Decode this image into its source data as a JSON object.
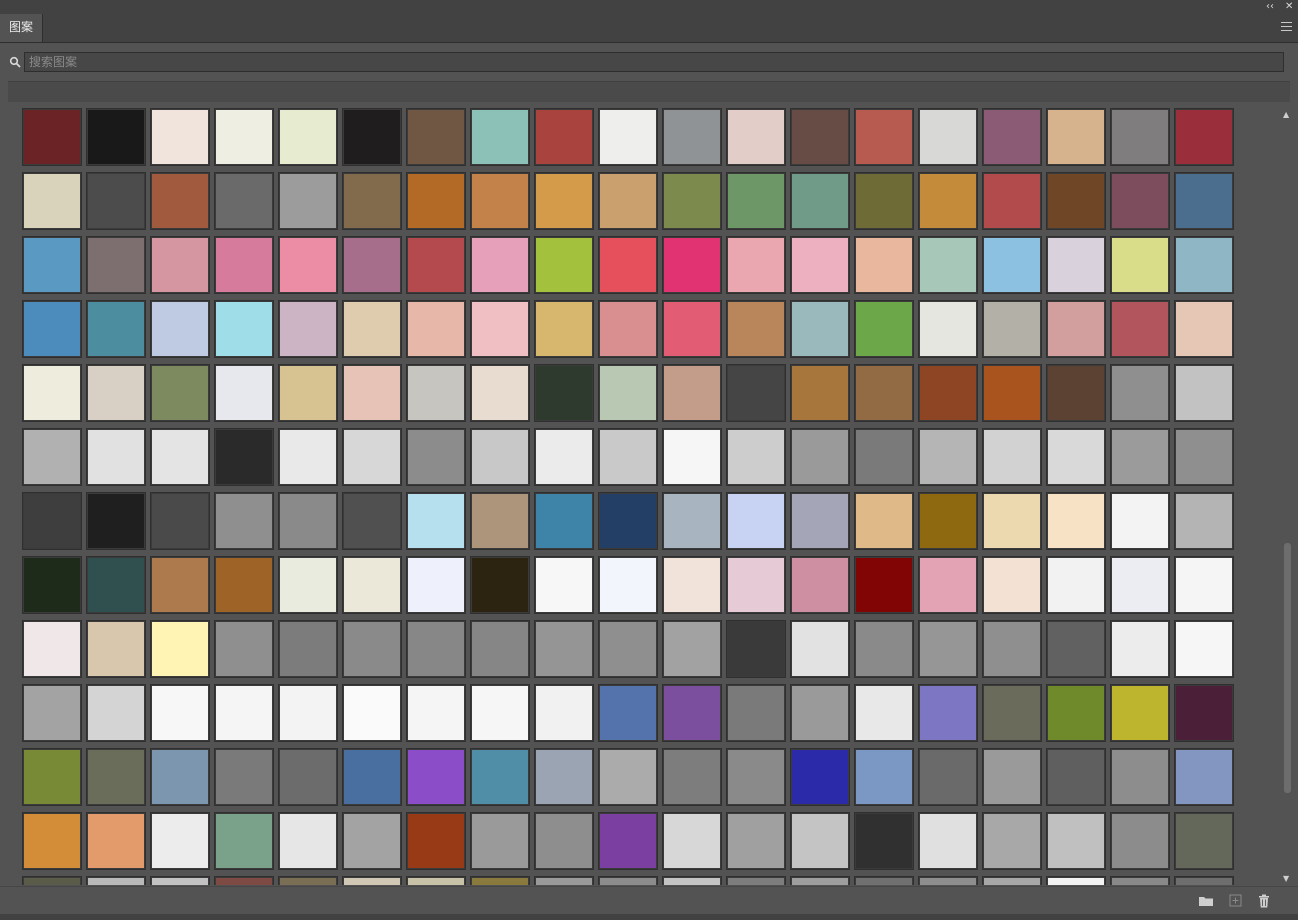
{
  "title_bar": {
    "collapse_glyph": "‹‹",
    "close_glyph": "✕"
  },
  "panel": {
    "tab_label": "图案"
  },
  "search": {
    "placeholder": "搜索图案",
    "value": ""
  },
  "swatches": {
    "row_colors": [
      [
        "#6b2326",
        "#191919",
        "#f1e4dd",
        "#efeee3",
        "#e7ebd0",
        "#201d1e",
        "#6f5744",
        "#8bc1b6",
        "#a9433d",
        "#eeeeec",
        "#909396",
        "#e3cdc8",
        "#674c45",
        "#b75b50",
        "#d8d8d6",
        "#8b5b76",
        "#d6b38d",
        "#7f7d7d",
        "#9a2e3a"
      ],
      [
        "#d9d3bb",
        "#4c4c4c",
        "#a15a3d",
        "#6a6a6a",
        "#9c9c9c",
        "#826a4d",
        "#b26a26",
        "#c3824a",
        "#d49b4b",
        "#c9a06e",
        "#7c8a4d",
        "#6d9766",
        "#6f9b88",
        "#6f6b37",
        "#c48c3a",
        "#b24c4c",
        "#6f4726",
        "#7d4c5d",
        "#4b6e8e"
      ],
      [
        "#5a9ac2",
        "#7d6e70",
        "#d696a1",
        "#d77b9c",
        "#ec8ca5",
        "#a76e8c",
        "#b54a4e",
        "#e7a0ba",
        "#a4c13d",
        "#e5505c",
        "#e13372",
        "#eaa7b0",
        "#ecb0c0",
        "#e9b79e",
        "#a7c7b8",
        "#8cc1e2",
        "#d9d2dd",
        "#d9dd8a",
        "#8fb6c5"
      ],
      [
        "#4c8cbc",
        "#4c8ea0",
        "#bfcbe2",
        "#9fdde8",
        "#cdb4c5",
        "#dfcbae",
        "#e7b7aa",
        "#f0bfc3",
        "#d7b66e",
        "#d98f8f",
        "#e25c74",
        "#b9855a",
        "#9ab9bd",
        "#6ca84a",
        "#e4e6df",
        "#b3b0a8",
        "#d39e9e",
        "#b2555d",
        "#e6c6b4"
      ],
      [
        "#eeeddd",
        "#d8d0c4",
        "#7d8a60",
        "#e7e7ee",
        "#d6c391",
        "#e7c3b7",
        "#c7c5bf",
        "#e8dcd0",
        "#2e3a2d",
        "#b8c8b2",
        "#c39c8a",
        "#454545",
        "#a6763c",
        "#926b44",
        "#8e4524",
        "#a9531e",
        "#5b4232",
        "#8f8f8f",
        "#c2c2c2"
      ],
      [
        "#b1b1b1",
        "#e1e1e1",
        "#e4e4e4",
        "#2a2a2a",
        "#e9e9e9",
        "#d7d7d7",
        "#8c8c8c",
        "#c8c8c8",
        "#ebebeb",
        "#c9c9c9",
        "#f6f6f6",
        "#cdcdcd",
        "#9a9a9a",
        "#7a7a7a",
        "#b5b5b5",
        "#d2d2d2",
        "#d9d9d9",
        "#9b9b9b",
        "#8f8f8f"
      ],
      [
        "#3e3e3e",
        "#1f1f1f",
        "#4a4a4a",
        "#8f8f8f",
        "#8a8a8a",
        "#505050",
        "#b6e0ee",
        "#ac957a",
        "#3e84a9",
        "#243f66",
        "#a9b4c1",
        "#c8d2f3",
        "#a5a5b8",
        "#dfb987",
        "#8e6910",
        "#edd9b0",
        "#f8e2c6",
        "#f3f3f4",
        "#b4b4b4"
      ],
      [
        "#1e2a1a",
        "#30504f",
        "#ac7a4d",
        "#9e6327",
        "#e9ebdf",
        "#ebe8da",
        "#eef0fb",
        "#2c2410",
        "#f7f7f7",
        "#f3f5fc",
        "#f1e3d9",
        "#e6cbd6",
        "#cd8fa1",
        "#820506",
        "#e4a2b5",
        "#f3e1d3",
        "#f2f2f2",
        "#ececf3",
        "#f5f5f5"
      ],
      [
        "#f0e8e8",
        "#d9c7ad",
        "#fff4b3",
        "#8f8f8f",
        "#7c7c7c",
        "#8a8a8a",
        "#878787",
        "#868686",
        "#959595",
        "#8f8f8f",
        "#a2a2a2",
        "#3a3a3a",
        "#e2e2e2",
        "#8a8a8a",
        "#969696",
        "#8f8f8f",
        "#616161",
        "#ececec",
        "#f6f6f6"
      ],
      [
        "#a3a3a3",
        "#d4d4d4",
        "#f7f7f7",
        "#f5f5f5",
        "#f3f3f3",
        "#fafafa",
        "#f5f5f5",
        "#f6f6f6",
        "#f1f1f1",
        "#5473ad",
        "#7b4f9d",
        "#7a7a7a",
        "#9a9a9a",
        "#e8e8e8",
        "#7d77c3",
        "#6b6b5b",
        "#6f8a2b",
        "#bdb52e",
        "#4b1f37"
      ],
      [
        "#788a36",
        "#6a6d59",
        "#7b96ae",
        "#7a7a7a",
        "#6c6c6c",
        "#486fa0",
        "#8c4ec8",
        "#4f8ea6",
        "#9ba4b2",
        "#ababab",
        "#7d7d7d",
        "#8a8a8a",
        "#2b2aa8",
        "#7b97c4",
        "#6a6a6a",
        "#9a9a9a",
        "#5f5f5f",
        "#8d8d8d",
        "#8296c1"
      ],
      [
        "#d38c38",
        "#e39b6c",
        "#ececec",
        "#7aa28a",
        "#e6e6e6",
        "#a3a3a3",
        "#993a17",
        "#9a9a9a",
        "#8e8e8e",
        "#7b3ea1",
        "#d7d7d7",
        "#a0a0a0",
        "#c4c4c4",
        "#303030",
        "#e0e0e0",
        "#a8a8a8",
        "#c0c0c0",
        "#8c8c8c",
        "#64685a"
      ],
      [
        "#5b5b4a",
        "#b9b9b9",
        "#c2c2c2",
        "#7d4a44",
        "#7a6f55",
        "#d0c8b5",
        "#c8c2a8",
        "#8b7a3d",
        "#9a9a9a",
        "#8c8c8c",
        "#c4c4c4",
        "#7d7d7d",
        "#9e9e9e",
        "#707070",
        "#8e8e8e",
        "#a7a7a7",
        "#f2f2f2",
        "#898989",
        "#6e6e6e"
      ]
    ]
  },
  "footer": {
    "new_group_icon": "folder-icon",
    "new_pattern_icon": "plus-square-icon",
    "delete_icon": "trash-icon"
  }
}
